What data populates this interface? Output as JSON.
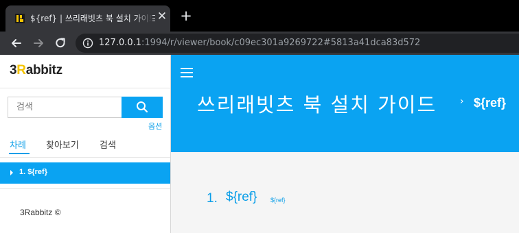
{
  "browser": {
    "tab_title": "${ref} | 쓰리래빗츠 북 설치 가이드",
    "tab_close": "✕",
    "new_tab": "+",
    "url_host": "127.0.0.1",
    "url_rest": ":1994/r/viewer/book/c09ec301a9269722#5813a41dca83d572"
  },
  "sidebar": {
    "logo_prefix": "3",
    "logo_r": "R",
    "logo_suffix": "abbitz",
    "search_placeholder": "검색",
    "options_label": "옵션",
    "tabs": [
      {
        "label": "차례"
      },
      {
        "label": "찾아보기"
      },
      {
        "label": "검색"
      }
    ],
    "toc_items": [
      {
        "label": "1.  ${ref}"
      }
    ],
    "footer": "3Rabbitz ©"
  },
  "header": {
    "book_title": "쓰리래빗츠 북 설치 가이드",
    "breadcrumb_sep": "›",
    "breadcrumb": "${ref}"
  },
  "content": {
    "section_number": "1.",
    "section_title": "${ref}",
    "section_ref": "${ref}"
  },
  "colors": {
    "accent": "#0aa3f2",
    "logo_accent": "#f5c400",
    "chrome_dark": "#35363a"
  }
}
